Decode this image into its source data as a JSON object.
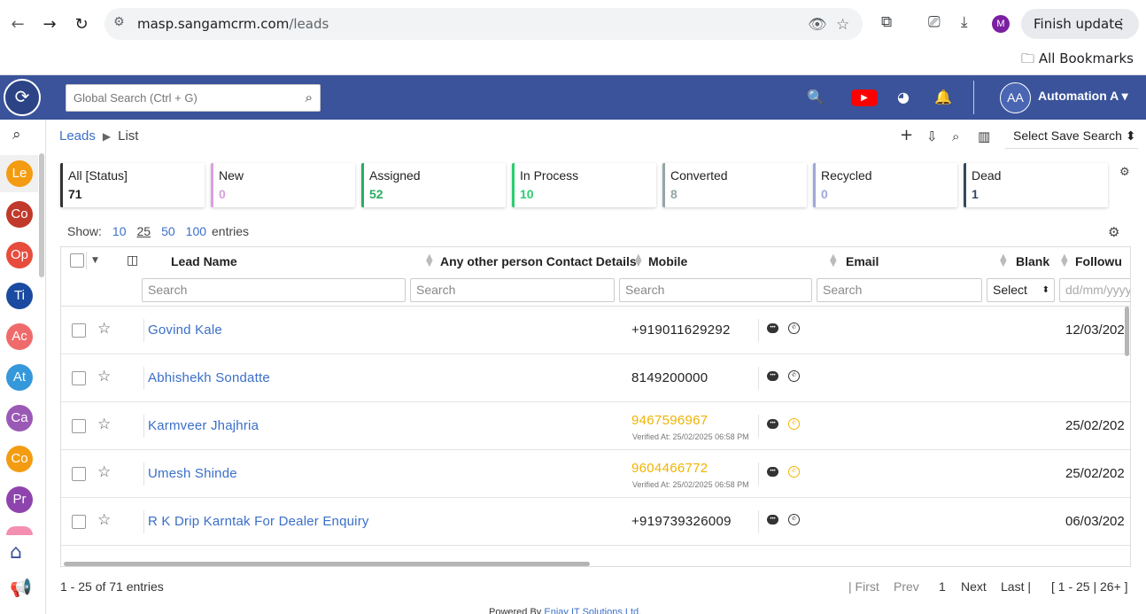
{
  "browser": {
    "url_host": "masp.sangamcrm.com",
    "url_path": "/leads",
    "profile_initial": "M",
    "finish_update_label": "Finish update",
    "all_bookmarks_label": "All Bookmarks"
  },
  "header": {
    "global_search_placeholder": "Global Search (Ctrl + G)",
    "user_initials": "AA",
    "user_name": "Automation A"
  },
  "sidebar": {
    "items": [
      {
        "label": "Le",
        "color": "#f39c12"
      },
      {
        "label": "Co",
        "color": "#c0392b"
      },
      {
        "label": "Op",
        "color": "#e74c3c"
      },
      {
        "label": "Ti",
        "color": "#1a4ba0"
      },
      {
        "label": "Ac",
        "color": "#ef6b6b"
      },
      {
        "label": "At",
        "color": "#3498db"
      },
      {
        "label": "Ca",
        "color": "#9b59b6"
      },
      {
        "label": "Co",
        "color": "#f39c12"
      },
      {
        "label": "Pr",
        "color": "#8e44ad"
      }
    ]
  },
  "breadcrumb": {
    "module": "Leads",
    "page": "List"
  },
  "toolbar": {
    "save_search_label": "Select Save Search"
  },
  "status_cards": [
    {
      "label": "All [Status]",
      "count": "71",
      "color": "#333333"
    },
    {
      "label": "New",
      "count": "0",
      "color": "#d9a0e0"
    },
    {
      "label": "Assigned",
      "count": "52",
      "color": "#27ae60"
    },
    {
      "label": "In Process",
      "count": "10",
      "color": "#2ecc71"
    },
    {
      "label": "Converted",
      "count": "8",
      "color": "#95a5a6"
    },
    {
      "label": "Recycled",
      "count": "0",
      "color": "#9fa8da"
    },
    {
      "label": "Dead",
      "count": "1",
      "color": "#34495e"
    }
  ],
  "show_entries": {
    "label": "Show:",
    "options": [
      "10",
      "25",
      "50",
      "100"
    ],
    "selected": "25",
    "suffix": "entries"
  },
  "table": {
    "columns": {
      "lead_name": "Lead Name",
      "other_contact": "Any other person Contact Details",
      "mobile": "Mobile",
      "email": "Email",
      "blank": "Blank",
      "followup": "Followu"
    },
    "filters": {
      "search_placeholder": "Search",
      "select_label": "Select",
      "date_placeholder": "dd/mm/yyyy"
    },
    "rows": [
      {
        "name": "Govind Kale",
        "mobile": "+919011629292",
        "verified": "",
        "followup": "12/03/202"
      },
      {
        "name": "Abhishekh Sondatte",
        "mobile": "8149200000",
        "verified": "",
        "followup": ""
      },
      {
        "name": "Karmveer Jhajhria",
        "mobile": "9467596967",
        "verified": "Verified At: 25/02/2025 06:58 PM",
        "followup": "25/02/202"
      },
      {
        "name": "Umesh Shinde",
        "mobile": "9604466772",
        "verified": "Verified At: 25/02/2025 06:58 PM",
        "followup": "25/02/202"
      },
      {
        "name": "R K Drip Karntak For Dealer Enquiry",
        "mobile": "+919739326009",
        "verified": "",
        "followup": "06/03/202"
      }
    ]
  },
  "footer": {
    "entries_info": "1 - 25 of 71 entries",
    "first": "| First",
    "prev": "Prev",
    "current_page": "1",
    "next": "Next",
    "last": "Last |",
    "range": "[ 1 - 25 | 26+ ]",
    "powered_prefix": "Powered By",
    "powered_company": "Enjay IT Solutions Ltd."
  }
}
